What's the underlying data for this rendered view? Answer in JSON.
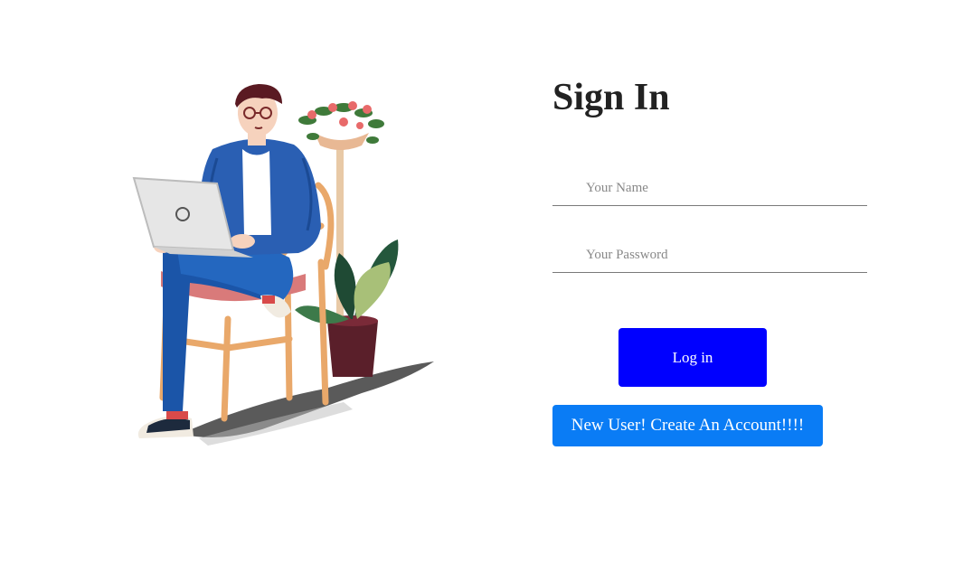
{
  "form": {
    "title": "Sign In",
    "name_placeholder": "Your Name",
    "password_placeholder": "Your Password",
    "login_label": "Log in",
    "create_account_label": "New User! Create An Account!!!!"
  },
  "colors": {
    "login_button": "#0000ff",
    "create_account_button": "#0a7cf5",
    "title_text": "#222222"
  },
  "icons": {
    "illustration": "person-with-laptop-illustration"
  }
}
